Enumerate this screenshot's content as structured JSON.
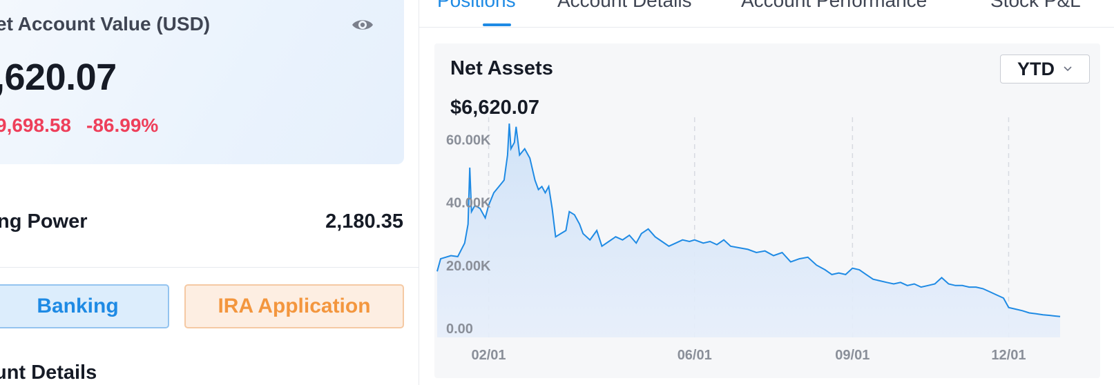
{
  "account": {
    "net_value_title": "et Account Value (USD)",
    "net_value": ",620.07",
    "change_amount": "9,698.58",
    "change_percent": "-86.99%",
    "buying_power_label": "ng Power",
    "buying_power_value": "2,180.35",
    "banking_button": "Banking",
    "ira_button": "IRA Application",
    "details_title": "unt Details"
  },
  "tabs": [
    {
      "label": "Positions",
      "active": true
    },
    {
      "label": "Account Details",
      "active": false
    },
    {
      "label": "Account Performance",
      "active": false
    },
    {
      "label": "Stock P&L",
      "active": false
    }
  ],
  "chart": {
    "title": "Net Assets",
    "amount": "$6,620.07",
    "period": "YTD"
  },
  "colors": {
    "accent": "#1e8ae4",
    "negative": "#ee3f5a",
    "ira": "#f3963e"
  },
  "chart_data": {
    "type": "area",
    "ylim": [
      0,
      70000
    ],
    "y_ticks": [
      {
        "value": 0,
        "label": "0.00"
      },
      {
        "value": 20000,
        "label": "20.00K"
      },
      {
        "value": 40000,
        "label": "40.00K"
      },
      {
        "value": 60000,
        "label": "60.00K"
      }
    ],
    "x_ticks": [
      {
        "date": "02/01",
        "label": "02/01"
      },
      {
        "date": "06/01",
        "label": "06/01"
      },
      {
        "date": "09/01",
        "label": "09/01"
      },
      {
        "date": "12/01",
        "label": "12/01"
      }
    ],
    "grid": "vertical-dashed",
    "legend": "none",
    "x_domain": [
      "01/02",
      "12/31"
    ],
    "series": [
      {
        "color": "#1e8ae4",
        "points": [
          [
            "01/02",
            21000
          ],
          [
            "01/04",
            25000
          ],
          [
            "01/07",
            25500
          ],
          [
            "01/10",
            26000
          ],
          [
            "01/14",
            25700
          ],
          [
            "01/18",
            30000
          ],
          [
            "01/20",
            36000
          ],
          [
            "01/21",
            54000
          ],
          [
            "01/22",
            40000
          ],
          [
            "01/24",
            42000
          ],
          [
            "01/27",
            41000
          ],
          [
            "01/30",
            38000
          ],
          [
            "02/01",
            42000
          ],
          [
            "02/04",
            46000
          ],
          [
            "02/07",
            48000
          ],
          [
            "02/10",
            50000
          ],
          [
            "02/12",
            58000
          ],
          [
            "02/13",
            68000
          ],
          [
            "02/14",
            60000
          ],
          [
            "02/16",
            62000
          ],
          [
            "02/17",
            67000
          ],
          [
            "02/19",
            58000
          ],
          [
            "02/22",
            60000
          ],
          [
            "02/25",
            57000
          ],
          [
            "02/28",
            50000
          ],
          [
            "03/02",
            47000
          ],
          [
            "03/04",
            48000
          ],
          [
            "03/06",
            46000
          ],
          [
            "03/08",
            48000
          ],
          [
            "03/10",
            41000
          ],
          [
            "03/12",
            32000
          ],
          [
            "03/15",
            33000
          ],
          [
            "03/18",
            34000
          ],
          [
            "03/20",
            40000
          ],
          [
            "03/23",
            39000
          ],
          [
            "03/26",
            36000
          ],
          [
            "03/28",
            33000
          ],
          [
            "04/01",
            31000
          ],
          [
            "04/05",
            34000
          ],
          [
            "04/08",
            29000
          ],
          [
            "04/12",
            30500
          ],
          [
            "04/16",
            32000
          ],
          [
            "04/20",
            31000
          ],
          [
            "04/24",
            32500
          ],
          [
            "04/28",
            30000
          ],
          [
            "05/01",
            33000
          ],
          [
            "05/05",
            34500
          ],
          [
            "05/09",
            32000
          ],
          [
            "05/13",
            30500
          ],
          [
            "05/17",
            29000
          ],
          [
            "05/21",
            30000
          ],
          [
            "05/25",
            31000
          ],
          [
            "05/29",
            30500
          ],
          [
            "06/01",
            31000
          ],
          [
            "06/06",
            30000
          ],
          [
            "06/10",
            30500
          ],
          [
            "06/14",
            29500
          ],
          [
            "06/18",
            31000
          ],
          [
            "06/22",
            29000
          ],
          [
            "06/27",
            28500
          ],
          [
            "07/02",
            28000
          ],
          [
            "07/07",
            27000
          ],
          [
            "07/12",
            27500
          ],
          [
            "07/17",
            26000
          ],
          [
            "07/22",
            27000
          ],
          [
            "07/27",
            24000
          ],
          [
            "08/01",
            25000
          ],
          [
            "08/06",
            25500
          ],
          [
            "08/11",
            23000
          ],
          [
            "08/16",
            21500
          ],
          [
            "08/20",
            20000
          ],
          [
            "08/24",
            20500
          ],
          [
            "08/28",
            20000
          ],
          [
            "09/01",
            22000
          ],
          [
            "09/05",
            21500
          ],
          [
            "09/09",
            20000
          ],
          [
            "09/13",
            18500
          ],
          [
            "09/17",
            18000
          ],
          [
            "09/21",
            17500
          ],
          [
            "09/25",
            17000
          ],
          [
            "09/29",
            17500
          ],
          [
            "10/03",
            16500
          ],
          [
            "10/07",
            17000
          ],
          [
            "10/11",
            16000
          ],
          [
            "10/15",
            16500
          ],
          [
            "10/19",
            17000
          ],
          [
            "10/23",
            19000
          ],
          [
            "10/27",
            17000
          ],
          [
            "10/31",
            16500
          ],
          [
            "11/04",
            16500
          ],
          [
            "11/08",
            16000
          ],
          [
            "11/12",
            16000
          ],
          [
            "11/16",
            15500
          ],
          [
            "11/20",
            14500
          ],
          [
            "11/24",
            13500
          ],
          [
            "11/28",
            12500
          ],
          [
            "12/01",
            9500
          ],
          [
            "12/05",
            9000
          ],
          [
            "12/09",
            8500
          ],
          [
            "12/13",
            7800
          ],
          [
            "12/17",
            7500
          ],
          [
            "12/21",
            7200
          ],
          [
            "12/25",
            7000
          ],
          [
            "12/28",
            6800
          ],
          [
            "12/31",
            6620
          ]
        ]
      }
    ]
  }
}
